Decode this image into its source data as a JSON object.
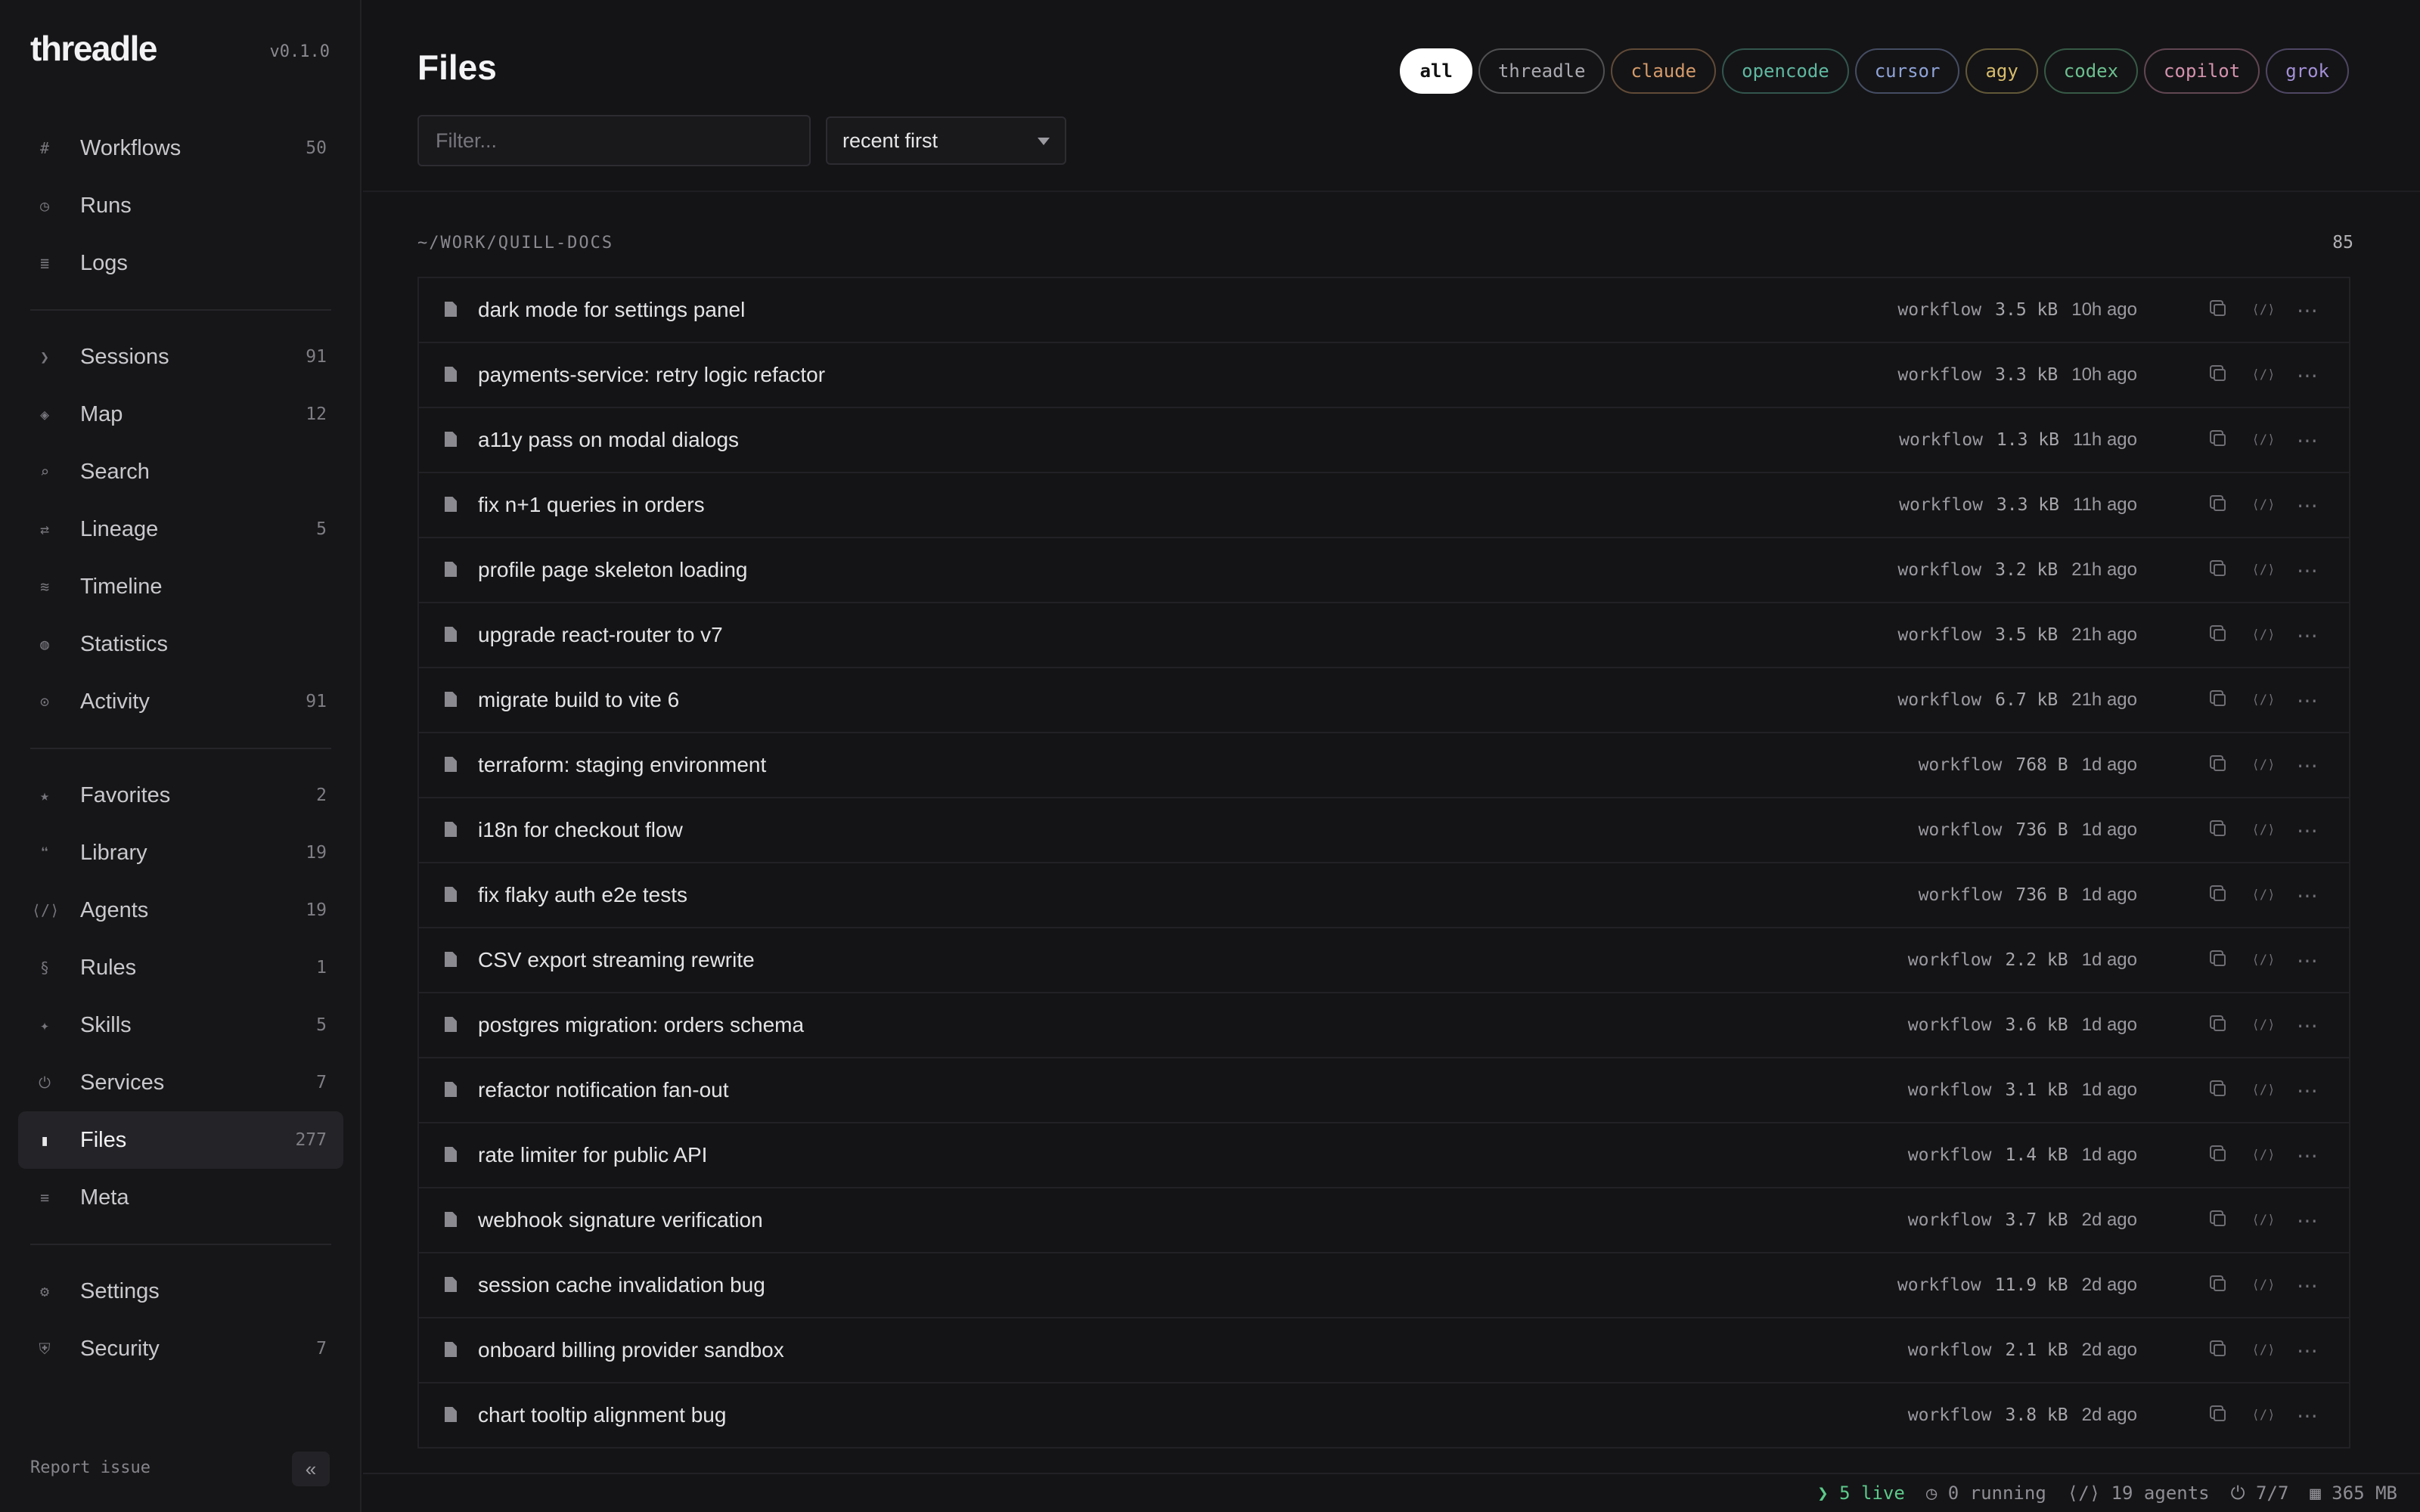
{
  "app": {
    "name": "threadle",
    "version": "v0.1.0"
  },
  "sidebar": {
    "groups": [
      [
        {
          "icon": "#",
          "icon_name": "hash-icon",
          "label": "Workflows",
          "count": "50"
        },
        {
          "icon": "◷",
          "icon_name": "clock-icon",
          "label": "Runs",
          "count": ""
        },
        {
          "icon": "≣",
          "icon_name": "log-icon",
          "label": "Logs",
          "count": ""
        }
      ],
      [
        {
          "icon": "❯",
          "icon_name": "terminal-icon",
          "label": "Sessions",
          "count": "91"
        },
        {
          "icon": "◈",
          "icon_name": "map-icon",
          "label": "Map",
          "count": "12"
        },
        {
          "icon": "⌕",
          "icon_name": "search-icon",
          "label": "Search",
          "count": ""
        },
        {
          "icon": "⇄",
          "icon_name": "lineage-icon",
          "label": "Lineage",
          "count": "5"
        },
        {
          "icon": "≋",
          "icon_name": "timeline-icon",
          "label": "Timeline",
          "count": ""
        },
        {
          "icon": "◍",
          "icon_name": "statistics-icon",
          "label": "Statistics",
          "count": ""
        },
        {
          "icon": "⊙",
          "icon_name": "activity-icon",
          "label": "Activity",
          "count": "91"
        }
      ],
      [
        {
          "icon": "★",
          "icon_name": "star-icon",
          "label": "Favorites",
          "count": "2"
        },
        {
          "icon": "❝",
          "icon_name": "quote-icon",
          "label": "Library",
          "count": "19"
        },
        {
          "icon": "⟨/⟩",
          "icon_name": "code-icon",
          "label": "Agents",
          "count": "19"
        },
        {
          "icon": "§",
          "icon_name": "section-icon",
          "label": "Rules",
          "count": "1"
        },
        {
          "icon": "✦",
          "icon_name": "sparkle-icon",
          "label": "Skills",
          "count": "5"
        },
        {
          "icon": "⏻",
          "icon_name": "power-icon",
          "label": "Services",
          "count": "7"
        },
        {
          "icon": "▮",
          "icon_name": "file-icon",
          "label": "Files",
          "count": "277",
          "active": true
        },
        {
          "icon": "≡",
          "icon_name": "meta-icon",
          "label": "Meta",
          "count": ""
        }
      ],
      [
        {
          "icon": "⚙",
          "icon_name": "gear-icon",
          "label": "Settings",
          "count": ""
        },
        {
          "icon": "⛨",
          "icon_name": "shield-icon",
          "label": "Security",
          "count": "7"
        }
      ]
    ],
    "report_label": "Report issue",
    "collapse_label": "«"
  },
  "header": {
    "title": "Files",
    "filter_placeholder": "Filter...",
    "sort_value": "recent first",
    "chips": [
      {
        "label": "all",
        "color": "#ffffff",
        "active": true
      },
      {
        "label": "threadle",
        "color": "#a9a9b0"
      },
      {
        "label": "claude",
        "color": "#d49a6a"
      },
      {
        "label": "opencode",
        "color": "#5fb8a0"
      },
      {
        "label": "cursor",
        "color": "#8fa3d8"
      },
      {
        "label": "agy",
        "color": "#d8bd6c"
      },
      {
        "label": "codex",
        "color": "#6cc08f"
      },
      {
        "label": "copilot",
        "color": "#d592ad"
      },
      {
        "label": "grok",
        "color": "#a490d8"
      }
    ]
  },
  "group": {
    "path": "~/WORK/QUILL-DOCS",
    "count": "85"
  },
  "files": [
    {
      "title": "dark mode for settings panel",
      "kind": "workflow",
      "size": "3.5 kB",
      "time": "10h ago"
    },
    {
      "title": "payments-service: retry logic refactor",
      "kind": "workflow",
      "size": "3.3 kB",
      "time": "10h ago"
    },
    {
      "title": "a11y pass on modal dialogs",
      "kind": "workflow",
      "size": "1.3 kB",
      "time": "11h ago"
    },
    {
      "title": "fix n+1 queries in orders",
      "kind": "workflow",
      "size": "3.3 kB",
      "time": "11h ago"
    },
    {
      "title": "profile page skeleton loading",
      "kind": "workflow",
      "size": "3.2 kB",
      "time": "21h ago"
    },
    {
      "title": "upgrade react-router to v7",
      "kind": "workflow",
      "size": "3.5 kB",
      "time": "21h ago"
    },
    {
      "title": "migrate build to vite 6",
      "kind": "workflow",
      "size": "6.7 kB",
      "time": "21h ago"
    },
    {
      "title": "terraform: staging environment",
      "kind": "workflow",
      "size": "768 B",
      "time": "1d ago"
    },
    {
      "title": "i18n for checkout flow",
      "kind": "workflow",
      "size": "736 B",
      "time": "1d ago"
    },
    {
      "title": "fix flaky auth e2e tests",
      "kind": "workflow",
      "size": "736 B",
      "time": "1d ago"
    },
    {
      "title": "CSV export streaming rewrite",
      "kind": "workflow",
      "size": "2.2 kB",
      "time": "1d ago"
    },
    {
      "title": "postgres migration: orders schema",
      "kind": "workflow",
      "size": "3.6 kB",
      "time": "1d ago"
    },
    {
      "title": "refactor notification fan-out",
      "kind": "workflow",
      "size": "3.1 kB",
      "time": "1d ago"
    },
    {
      "title": "rate limiter for public API",
      "kind": "workflow",
      "size": "1.4 kB",
      "time": "1d ago"
    },
    {
      "title": "webhook signature verification",
      "kind": "workflow",
      "size": "3.7 kB",
      "time": "2d ago"
    },
    {
      "title": "session cache invalidation bug",
      "kind": "workflow",
      "size": "11.9 kB",
      "time": "2d ago"
    },
    {
      "title": "onboard billing provider sandbox",
      "kind": "workflow",
      "size": "2.1 kB",
      "time": "2d ago"
    },
    {
      "title": "chart tooltip alignment bug",
      "kind": "workflow",
      "size": "3.8 kB",
      "time": "2d ago"
    }
  ],
  "statusbar": {
    "live": "❯ 5 live",
    "running": "◷ 0 running",
    "agents": "⟨/⟩ 19 agents",
    "services": "⏻ 7/7",
    "memory": "▦ 365 MB"
  }
}
